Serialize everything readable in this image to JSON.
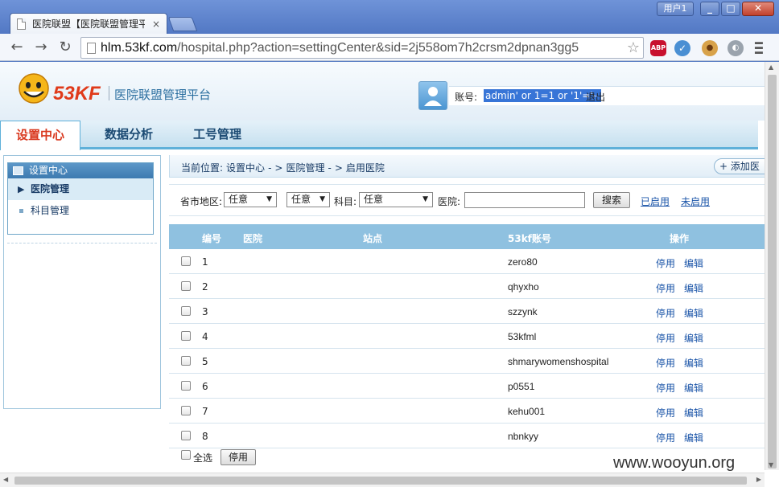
{
  "browser": {
    "tab_title": "医院联盟【医院联盟管理平",
    "tab_close": "×",
    "user_label": "用户1",
    "url_scheme": "",
    "url_host": "hlm.53kf.com",
    "url_path": "/hospital.php?action=settingCenter&sid=2j558om7h2crsm2dpnan3gg5",
    "extensions": [
      "abp-icon",
      "v-icon",
      "cookie-icon",
      "globe-icon"
    ],
    "abp_label": "ABP"
  },
  "header": {
    "logo_text": "53KF",
    "platform_title": "医院联盟管理平台",
    "account_label": "账号:",
    "account_value": "admin' or 1=1 or '1'='--",
    "logout": "退出"
  },
  "nav": {
    "items": [
      "设置中心",
      "数据分析",
      "工号管理"
    ]
  },
  "sidebar": {
    "title": "设置中心",
    "items": [
      "医院管理",
      "科目管理"
    ]
  },
  "breadcrumb": {
    "prefix": "当前位置:",
    "parts": [
      "设置中心",
      "医院管理",
      "启用医院"
    ],
    "sep": "-",
    "add_button": "+ 添加医"
  },
  "filter": {
    "region_label": "省市地区:",
    "region_value": "任意",
    "city_value": "任意",
    "subject_label": "科目:",
    "subject_value": "任意",
    "hospital_label": "医院:",
    "search_button": "搜索",
    "enabled_link": "已启用",
    "disabled_link": "未启用"
  },
  "table": {
    "headers": [
      "编号",
      "医院",
      "站点",
      "53kf账号",
      "操作"
    ],
    "rows": [
      {
        "no": "1",
        "account": "zero80"
      },
      {
        "no": "2",
        "account": "qhyxho"
      },
      {
        "no": "3",
        "account": "szzynk"
      },
      {
        "no": "4",
        "account": "53kfml"
      },
      {
        "no": "5",
        "account": "shmarywomenshospital"
      },
      {
        "no": "6",
        "account": "p0551"
      },
      {
        "no": "7",
        "account": "kehu001"
      },
      {
        "no": "8",
        "account": "nbnkyy"
      }
    ],
    "stop_label": "停用",
    "edit_label": "编辑",
    "select_all": "全选",
    "bulk_stop": "停用"
  },
  "watermark": "www.wooyun.org",
  "colors": {
    "accent": "#d9381e",
    "link": "#1a54a8",
    "table_header": "#8fc1e0",
    "selection": "#3875d7"
  }
}
